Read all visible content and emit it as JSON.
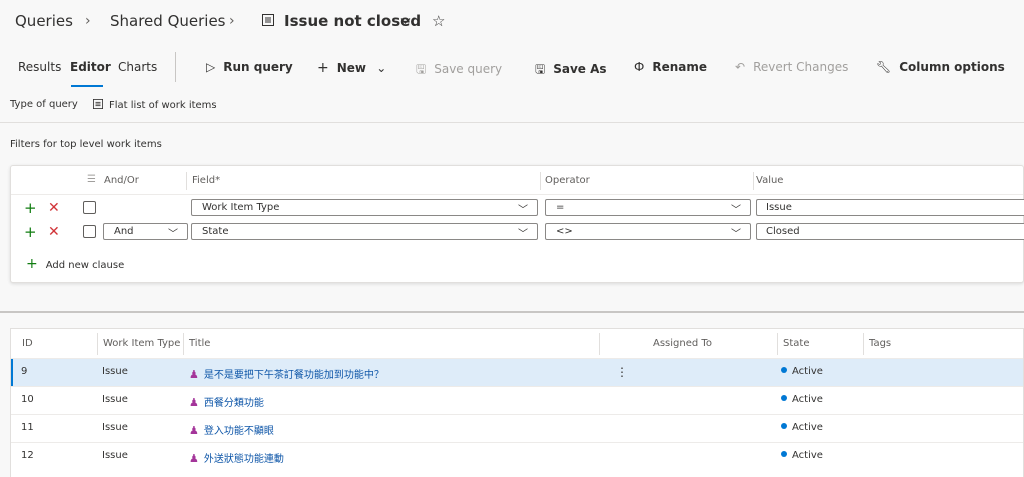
{
  "breadcrumb": {
    "root": "Queries",
    "folder": "Shared Queries",
    "query_title": "Issue not closed",
    "separator": "›"
  },
  "toolbar": {
    "tabs": [
      "Results",
      "Editor",
      "Charts"
    ],
    "active_tab": "Editor",
    "buttons": {
      "run": "Run query",
      "new": "New",
      "save": "Save query",
      "save_as": "Save As",
      "rename": "Rename",
      "revert": "Revert Changes",
      "column_options": "Column options"
    }
  },
  "query_type": {
    "label": "Type of query",
    "value": "Flat list of work items"
  },
  "filters": {
    "label": "Filters for top level work items",
    "columns": {
      "and_or": "And/Or",
      "field": "Field*",
      "operator": "Operator",
      "value": "Value"
    },
    "rows": [
      {
        "and_or": "",
        "field": "Work Item Type",
        "operator": "=",
        "value": "Issue"
      },
      {
        "and_or": "And",
        "field": "State",
        "operator": "<>",
        "value": "Closed"
      }
    ],
    "add_clause": "Add new clause"
  },
  "results": {
    "columns": {
      "id": "ID",
      "type": "Work Item Type",
      "title": "Title",
      "assigned": "Assigned To",
      "state": "State",
      "tags": "Tags"
    },
    "rows": [
      {
        "id": "9",
        "type": "Issue",
        "title": "是不是要把下午茶訂餐功能加到功能中？",
        "assigned": "",
        "state": "Active",
        "tags": ""
      },
      {
        "id": "10",
        "type": "Issue",
        "title": "西餐分類功能",
        "assigned": "",
        "state": "Active",
        "tags": ""
      },
      {
        "id": "11",
        "type": "Issue",
        "title": "登入功能不顯眼",
        "assigned": "",
        "state": "Active",
        "tags": ""
      },
      {
        "id": "12",
        "type": "Issue",
        "title": "外送狀態功能連動",
        "assigned": "",
        "state": "Active",
        "tags": ""
      }
    ]
  },
  "colors": {
    "accent": "#0078d4",
    "issue_icon": "#a4359a",
    "add_green": "#107c10",
    "remove_red": "#d13438",
    "selected_row": "#deecf9"
  }
}
